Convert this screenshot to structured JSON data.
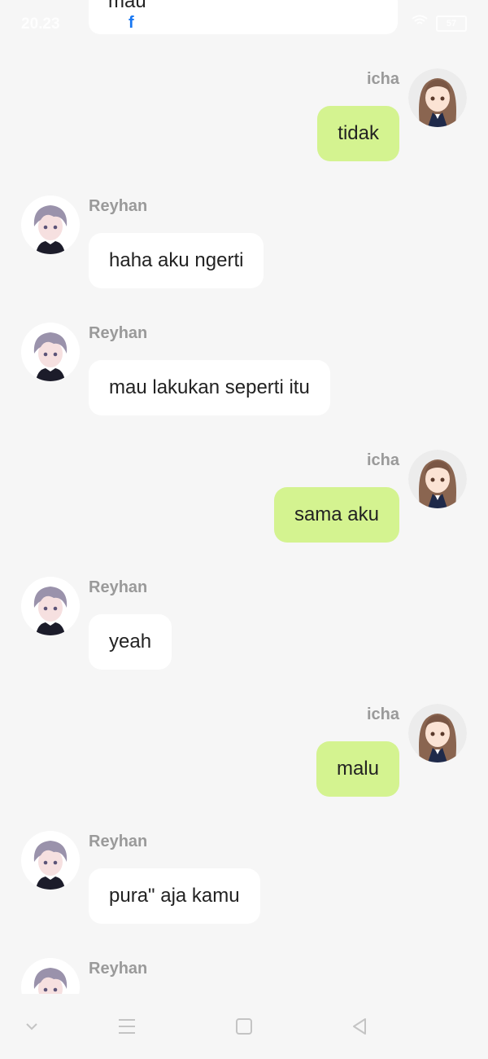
{
  "status_bar": {
    "time": "20.23",
    "battery": "57",
    "fb_icon": "facebook-icon"
  },
  "colors": {
    "background": "#f6f6f6",
    "incoming_bubble": "#ffffff",
    "outgoing_bubble": "#d4f390",
    "name_text": "#9a9a9a"
  },
  "top_partial_message": {
    "text": "mau"
  },
  "messages": [
    {
      "sender": "icha",
      "side": "right",
      "text": "tidak"
    },
    {
      "sender": "Reyhan",
      "side": "left",
      "text": "haha aku ngerti"
    },
    {
      "sender": "Reyhan",
      "side": "left",
      "text": "mau lakukan seperti itu"
    },
    {
      "sender": "icha",
      "side": "right",
      "text": "sama aku"
    },
    {
      "sender": "Reyhan",
      "side": "left",
      "text": "yeah"
    },
    {
      "sender": "icha",
      "side": "right",
      "text": "malu"
    },
    {
      "sender": "Reyhan",
      "side": "left",
      "text": "pura\" aja kamu"
    },
    {
      "sender": "Reyhan",
      "side": "left",
      "text": ""
    }
  ],
  "nav_bar": {
    "buttons": [
      "chevron-down-icon",
      "menu-icon",
      "home-square-icon",
      "back-triangle-icon"
    ]
  }
}
